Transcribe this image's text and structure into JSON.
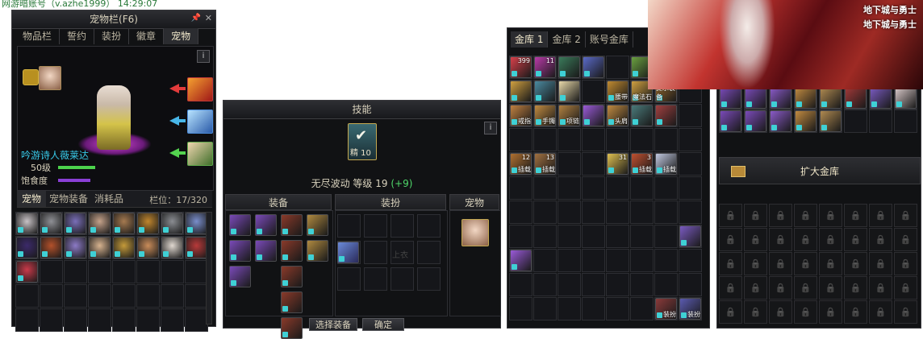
{
  "top_text": "网游暗账号（v.azhe1999）  14:29:07",
  "pet_window": {
    "title": "宠物栏(F6)",
    "tabs": [
      "物品栏",
      "誓约",
      "装扮",
      "徽章",
      "宠物"
    ],
    "active_tab": "宠物",
    "pet_name": "吟游诗人薇莱达",
    "level_label": "50级",
    "satiety_label": "饱食度",
    "level_progress": 0.6,
    "satiety_progress": 0.55,
    "bottom_tabs": [
      "宠物",
      "宠物装备",
      "消耗品"
    ],
    "slot_count": "栏位：17/320",
    "info_icon": "i"
  },
  "skill_window": {
    "title": "技能",
    "skill_icon_label": "精 10",
    "skill_line": "无尽波动 等级 19",
    "skill_bonus": "(+9)",
    "sections": [
      "装备",
      "装扮",
      "宠物"
    ],
    "slot_hint": "上衣",
    "buttons": [
      "选择装备",
      "确定"
    ],
    "info_icon": "i"
  },
  "storage_window": {
    "tabs": [
      "金库 1",
      "金库 2",
      "账号金库"
    ],
    "item_labels": {
      "potion_count": "399",
      "gem_count": "11",
      "waist": "腰带",
      "magic": "魔法石",
      "hint": "提示装备",
      "ring": "戒指",
      "bracelet": "手镯",
      "necklace": "项链",
      "shoulder": "头肩",
      "c12": "12",
      "c13": "13",
      "insert1": "插载",
      "insert2": "插载",
      "c31": "31",
      "c3": "3",
      "insert3": "插载",
      "insert4": "插载",
      "outfit1": "装扮",
      "outfit2": "装扮"
    }
  },
  "account_storage_window": {
    "expand_button": "扩大金库",
    "lock_icon": "🔒"
  },
  "banner": {
    "logo_text": "地下城与勇士"
  },
  "colors": {
    "accent_gold": "#e3c873",
    "lock_cyan": "#3fd0d5",
    "level_bar_green": "#4cd34c",
    "satiety_bar_purple": "#8a3fd6",
    "bonus_green": "#4fd86a"
  }
}
